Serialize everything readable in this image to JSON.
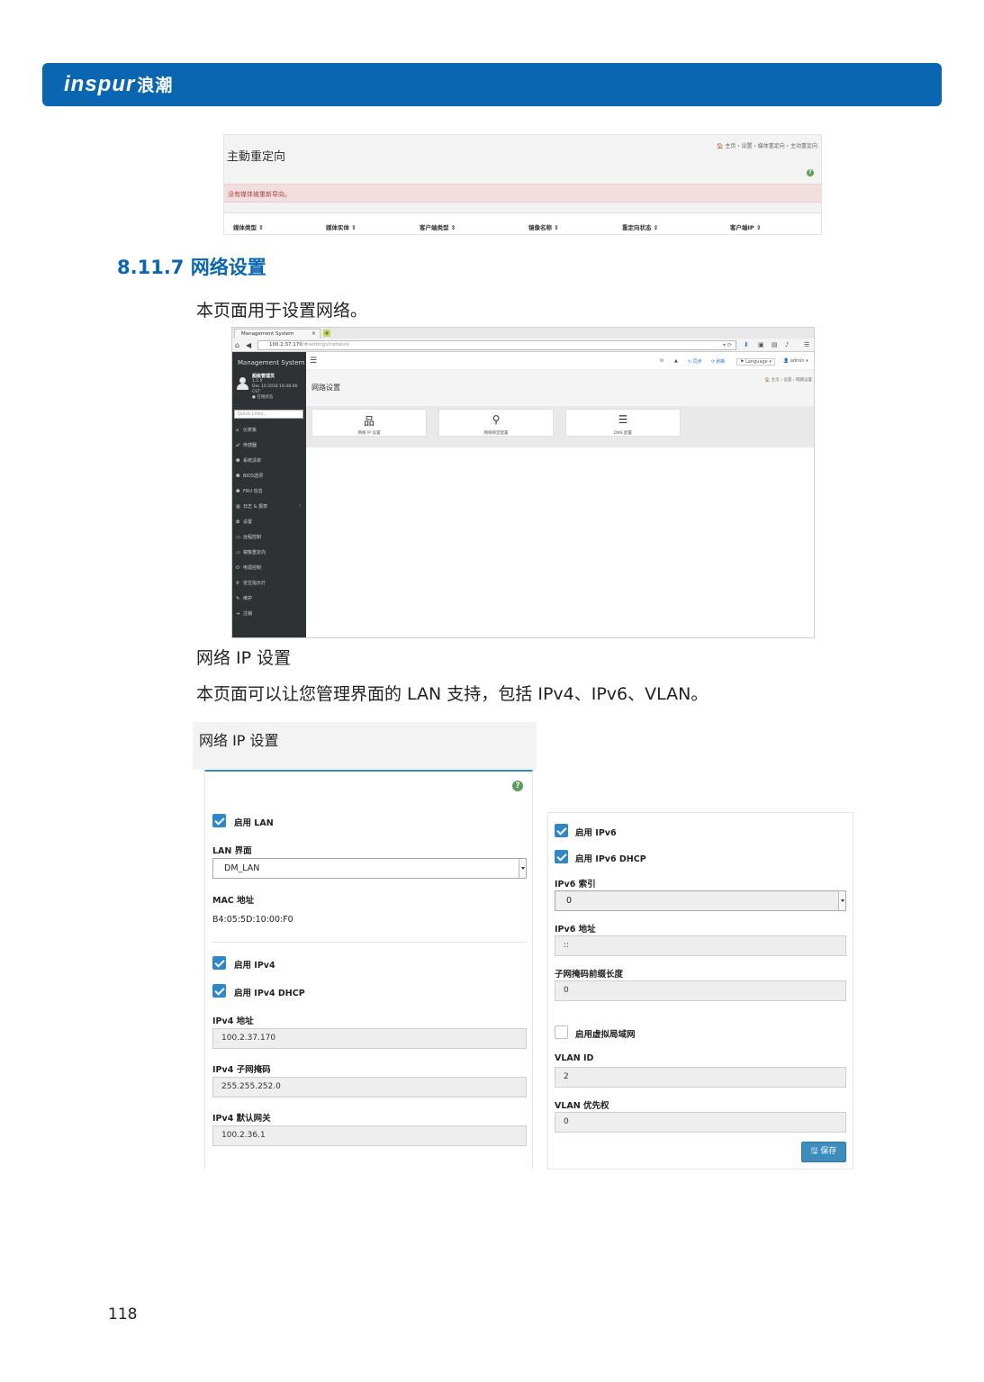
{
  "brand": {
    "logo_latin": "inspur",
    "logo_cn": "浪潮"
  },
  "redirect_shot": {
    "title": "主動重定向",
    "breadcrumb": "🏠 主页 › 设置 › 媒体重定向 › 主动重定向",
    "alert": "没有媒体被重新导向。",
    "columns": [
      "媒体类型 ⇕",
      "媒体实体 ⇕",
      "客户端类型 ⇕",
      "镜像名称 ⇕",
      "重定向状态 ⇕",
      "客户端IP ⇕"
    ]
  },
  "section": {
    "heading": "8.11.7 网络设置",
    "intro": "本页面用于设置网络。",
    "sub_heading": "网络 IP 设置",
    "sub_desc": "本页面可以让您管理界面的 LAN 支持，包括 IPv4、IPv6、VLAN。"
  },
  "browser_shot": {
    "tab_title": "Management System",
    "url_host": "100.2.37.170",
    "url_path": "/#settings/network",
    "sidebar": {
      "title": "Management System",
      "user_name": "超级管理员",
      "user_role": "1.1.0",
      "user_time": "Dec 10 2018 16:48:46 CST",
      "user_status": "● 在线状态",
      "search_placeholder": "Quick Links...",
      "items": [
        {
          "icon": "⌂",
          "label": "仪表板"
        },
        {
          "icon": "☍",
          "label": "传感器"
        },
        {
          "icon": "❶",
          "label": "系统清单"
        },
        {
          "icon": "❶",
          "label": "BIOS选项"
        },
        {
          "icon": "❶",
          "label": "FRU 信息"
        },
        {
          "icon": "▥",
          "label": "日志 & 报表"
        },
        {
          "icon": "✿",
          "label": "设置"
        },
        {
          "icon": "▭",
          "label": "远程控制"
        },
        {
          "icon": "▭",
          "label": "镜像重定向"
        },
        {
          "icon": "⏻",
          "label": "电源控制"
        },
        {
          "icon": "♀",
          "label": "定位指示灯"
        },
        {
          "icon": "✎",
          "label": "维护"
        },
        {
          "icon": "⇥",
          "label": "注销"
        }
      ]
    },
    "topbar": {
      "refresh_label": "⟳ 刷新",
      "sync_label": "↻ 同步",
      "language_label": "Language",
      "user_label": "admin"
    },
    "page_title": "网路设置",
    "breadcrumb": "🏠 主页 › 设置 › 网路设置",
    "tiles": [
      {
        "icon": "品",
        "label": "网络 IP 设置"
      },
      {
        "icon": "⚲",
        "label": "网络绑定配置"
      },
      {
        "icon": "☰",
        "label": "DNS 配置"
      }
    ]
  },
  "ip_settings": {
    "title": "网络 IP 设置",
    "enable_lan": "启用 LAN",
    "lan_interface_label": "LAN 界面",
    "lan_interface_value": "DM_LAN",
    "mac_label": "MAC 地址",
    "mac_value": "B4:05:5D:10:00:F0",
    "enable_ipv4": "启用 IPv4",
    "enable_ipv4_dhcp": "启用 IPv4 DHCP",
    "ipv4_addr_label": "IPv4 地址",
    "ipv4_addr_value": "100.2.37.170",
    "ipv4_mask_label": "IPv4 子网掩码",
    "ipv4_mask_value": "255.255.252.0",
    "ipv4_gw_label": "IPv4 默认网关",
    "ipv4_gw_value": "100.2.36.1",
    "enable_ipv6": "启用 IPv6",
    "enable_ipv6_dhcp": "启用 IPv6 DHCP",
    "ipv6_index_label": "IPv6 索引",
    "ipv6_index_value": "0",
    "ipv6_addr_label": "IPv6 地址",
    "ipv6_addr_value": "::",
    "prefix_label": "子网掩码前缀长度",
    "prefix_value": "0",
    "enable_vlan": "启用虚拟局域网",
    "vlan_id_label": "VLAN ID",
    "vlan_id_value": "2",
    "vlan_priority_label": "VLAN 优先权",
    "vlan_priority_value": "0",
    "save_label": "🖫 保存"
  },
  "page_number": "118"
}
